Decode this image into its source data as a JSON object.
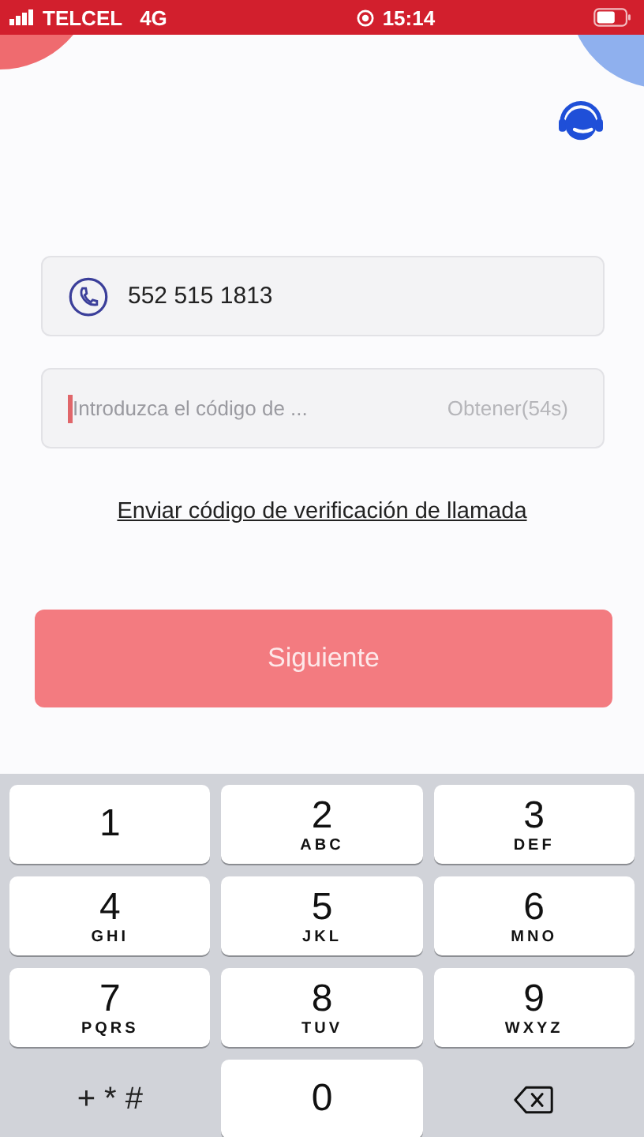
{
  "status_bar": {
    "carrier": "TELCEL",
    "network": "4G",
    "time": "15:14"
  },
  "phone_field": {
    "value": "552 515 1813"
  },
  "code_field": {
    "placeholder": "Introduzca el código de ...",
    "focused": true,
    "resend": "Obtener(54s)"
  },
  "call_link": "Enviar código de verificación de llamada",
  "next_button": {
    "label": "Siguiente",
    "disabled": true
  },
  "keypad": [
    {
      "kind": "digit",
      "digit": "1"
    },
    {
      "kind": "digit",
      "digit": "2",
      "letters": "ABC"
    },
    {
      "kind": "digit",
      "digit": "3",
      "letters": "DEF"
    },
    {
      "kind": "digit",
      "digit": "4",
      "letters": "GHI"
    },
    {
      "kind": "digit",
      "digit": "5",
      "letters": "JKL"
    },
    {
      "kind": "digit",
      "digit": "6",
      "letters": "MNO"
    },
    {
      "kind": "digit",
      "digit": "7",
      "letters": "PQRS"
    },
    {
      "kind": "digit",
      "digit": "8",
      "letters": "TUV"
    },
    {
      "kind": "digit",
      "digit": "9",
      "letters": "WXYZ"
    },
    {
      "kind": "symbols",
      "label": "+ * #"
    },
    {
      "kind": "digit",
      "digit": "0"
    },
    {
      "kind": "delete"
    }
  ]
}
